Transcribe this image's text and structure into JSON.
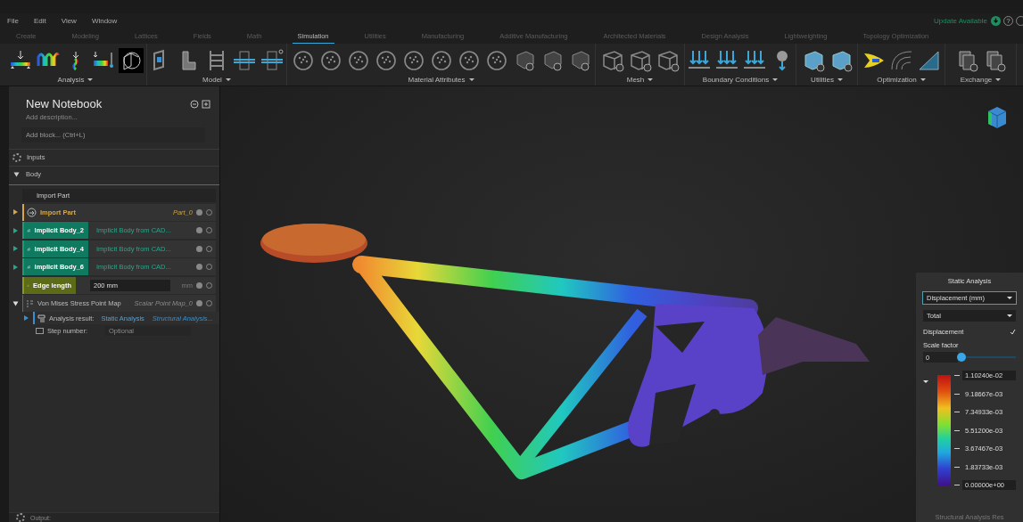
{
  "menu": [
    "File",
    "Edit",
    "View",
    "Window"
  ],
  "update": {
    "label": "Update Available",
    "help": "?"
  },
  "tabs": [
    {
      "label": "Create",
      "selected": false
    },
    {
      "label": "Modeling",
      "selected": false
    },
    {
      "label": "Lattices",
      "selected": false
    },
    {
      "label": "Fields",
      "selected": false
    },
    {
      "label": "Math",
      "selected": false
    },
    {
      "label": "Simulation",
      "selected": true
    },
    {
      "label": "Utilities",
      "selected": false
    },
    {
      "label": "Manufacturing",
      "selected": false
    },
    {
      "label": "Additive Manufacturing",
      "selected": false
    },
    {
      "label": "Architected Materials",
      "selected": false
    },
    {
      "label": "Design Analysis",
      "selected": false
    },
    {
      "label": "Lightweighting",
      "selected": false
    },
    {
      "label": "Topology Optimization",
      "selected": false
    }
  ],
  "toolbar_groups": [
    "Analysis",
    "Model",
    "Material Attributes",
    "Mesh",
    "Boundary Conditions",
    "Utilities",
    "Optimization",
    "Exchange"
  ],
  "notebook": {
    "title": "New Notebook",
    "description_placeholder": "Add description...",
    "add_block_placeholder": "Add block... (Ctrl+L)",
    "sections": [
      {
        "kind": "settings",
        "label": "Inputs"
      },
      {
        "kind": "group",
        "label": "Body",
        "expanded": true
      }
    ],
    "blocks_header": "Import Part",
    "blocks": [
      {
        "kind": "import",
        "name": "Import Part",
        "detail": "Part_0",
        "expanded": false
      },
      {
        "kind": "implicit",
        "name": "Implicit Body_2",
        "detail": "Implicit Body from CAD...",
        "expanded": false
      },
      {
        "kind": "implicit",
        "name": "Implicit Body_4",
        "detail": "Implicit Body from CAD...",
        "expanded": false
      },
      {
        "kind": "implicit",
        "name": "Implicit Body_6",
        "detail": "Implicit Body from CAD...",
        "expanded": false
      },
      {
        "kind": "field",
        "name": "Edge length",
        "value": "200 mm",
        "unit": "mm"
      },
      {
        "kind": "map",
        "name": "Von Mises Stress Point Map",
        "detail": "Scalar Point Map_0",
        "expanded": true,
        "children": [
          {
            "kind": "link",
            "label": "Analysis result:",
            "value": "Static Analysis",
            "detail": "Structural Analysis...",
            "expanded": false
          },
          {
            "kind": "input",
            "label": "Step number:",
            "placeholder": "Optional"
          }
        ]
      }
    ]
  },
  "results": {
    "title": "Static Analysis",
    "dropdowns": [
      "Displacement (mm)",
      "Total"
    ],
    "checkbox": {
      "label": "Displacement",
      "checked": true
    },
    "scale": {
      "label": "Scale factor",
      "value": "0",
      "level": 0
    },
    "legend": [
      "1.10240e-02",
      "9.18667e-03",
      "7.34933e-03",
      "5.51200e-03",
      "3.67467e-03",
      "1.83733e-03",
      "0.00000e+00"
    ],
    "footer": "Structural Analysis Res"
  },
  "output": {
    "label": "Output:"
  }
}
